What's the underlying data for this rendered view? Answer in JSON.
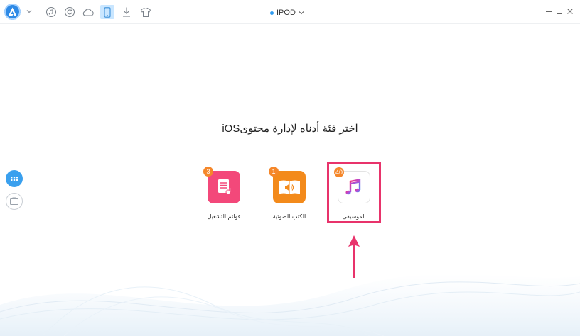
{
  "toolbar": {
    "icons": [
      "app-logo-icon",
      "music-icon",
      "restore-icon",
      "cloud-icon",
      "device-icon",
      "download-icon",
      "shirt-icon"
    ],
    "active_icon": "device-icon"
  },
  "device": {
    "name": "IPOD"
  },
  "window_controls": [
    "minimize",
    "maximize",
    "close"
  ],
  "main": {
    "heading": "iOSاختر فئة أدناه لإدارة محتوى"
  },
  "categories": [
    {
      "label": "قوائم التشغيل",
      "count": "3",
      "icon": "playlist-icon"
    },
    {
      "label": "الكتب الصوتية",
      "count": "1",
      "icon": "audiobook-icon"
    },
    {
      "label": "الموسيقى",
      "count": "40",
      "icon": "music-note-icon"
    }
  ],
  "colors": {
    "accent": "#2e8ae6",
    "badge": "#f5872a",
    "highlight": "#e8336b",
    "playlists_tile": "#f3487a",
    "audiobooks_tile": "#f38a1b"
  }
}
